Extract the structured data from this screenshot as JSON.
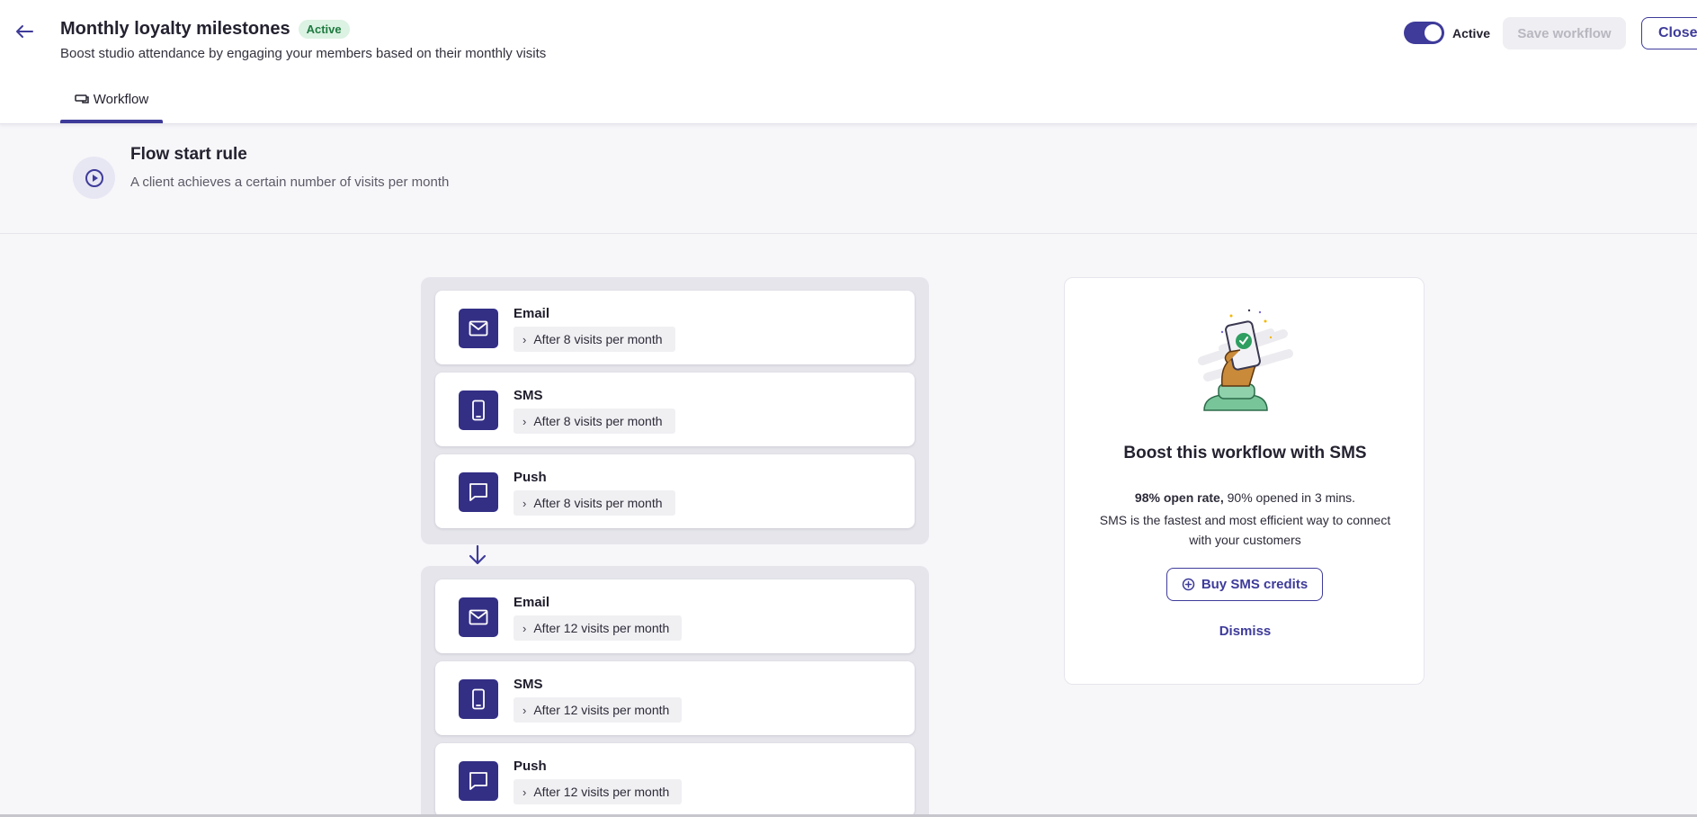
{
  "header": {
    "title": "Monthly loyalty milestones",
    "status_badge": "Active",
    "subtitle": "Boost studio attendance by engaging your members based on their monthly visits",
    "toggle_label": "Active",
    "toggle_on": true,
    "save_label": "Save workflow",
    "close_label": "Close",
    "tabs": [
      {
        "label": "Workflow",
        "icon": "workflow-icon",
        "active": true
      }
    ]
  },
  "start_rule": {
    "title": "Flow start rule",
    "description": "A client achieves a certain number of visits per month",
    "icon": "play-circle-icon"
  },
  "groups": [
    {
      "steps": [
        {
          "name": "Email",
          "icon": "mail-icon",
          "condition": "After 8 visits per month"
        },
        {
          "name": "SMS",
          "icon": "mobile-phone-icon",
          "condition": "After 8 visits per month"
        },
        {
          "name": "Push",
          "icon": "chat-bubble-icon",
          "condition": "After 8 visits per month"
        }
      ]
    },
    {
      "steps": [
        {
          "name": "Email",
          "icon": "mail-icon",
          "condition": "After 12 visits per month"
        },
        {
          "name": "SMS",
          "icon": "mobile-phone-icon",
          "condition": "After 12 visits per month"
        },
        {
          "name": "Push",
          "icon": "chat-bubble-icon",
          "condition": "After 12 visits per month"
        }
      ]
    }
  ],
  "promo": {
    "title": "Boost this workflow with SMS",
    "line1_bold": "98% open rate,",
    "line1_rest": " 90% opened in 3 mins.",
    "line2": "SMS is the fastest and most efficient way to connect with your customers",
    "buy_label": "Buy SMS credits",
    "dismiss_label": "Dismiss"
  },
  "colors": {
    "accent": "#3e3b9a",
    "step_icon_bg": "#332f85",
    "badge_bg": "#dcf2e3",
    "badge_text": "#1e7a3f",
    "canvas_bg": "#f7f7fa"
  }
}
